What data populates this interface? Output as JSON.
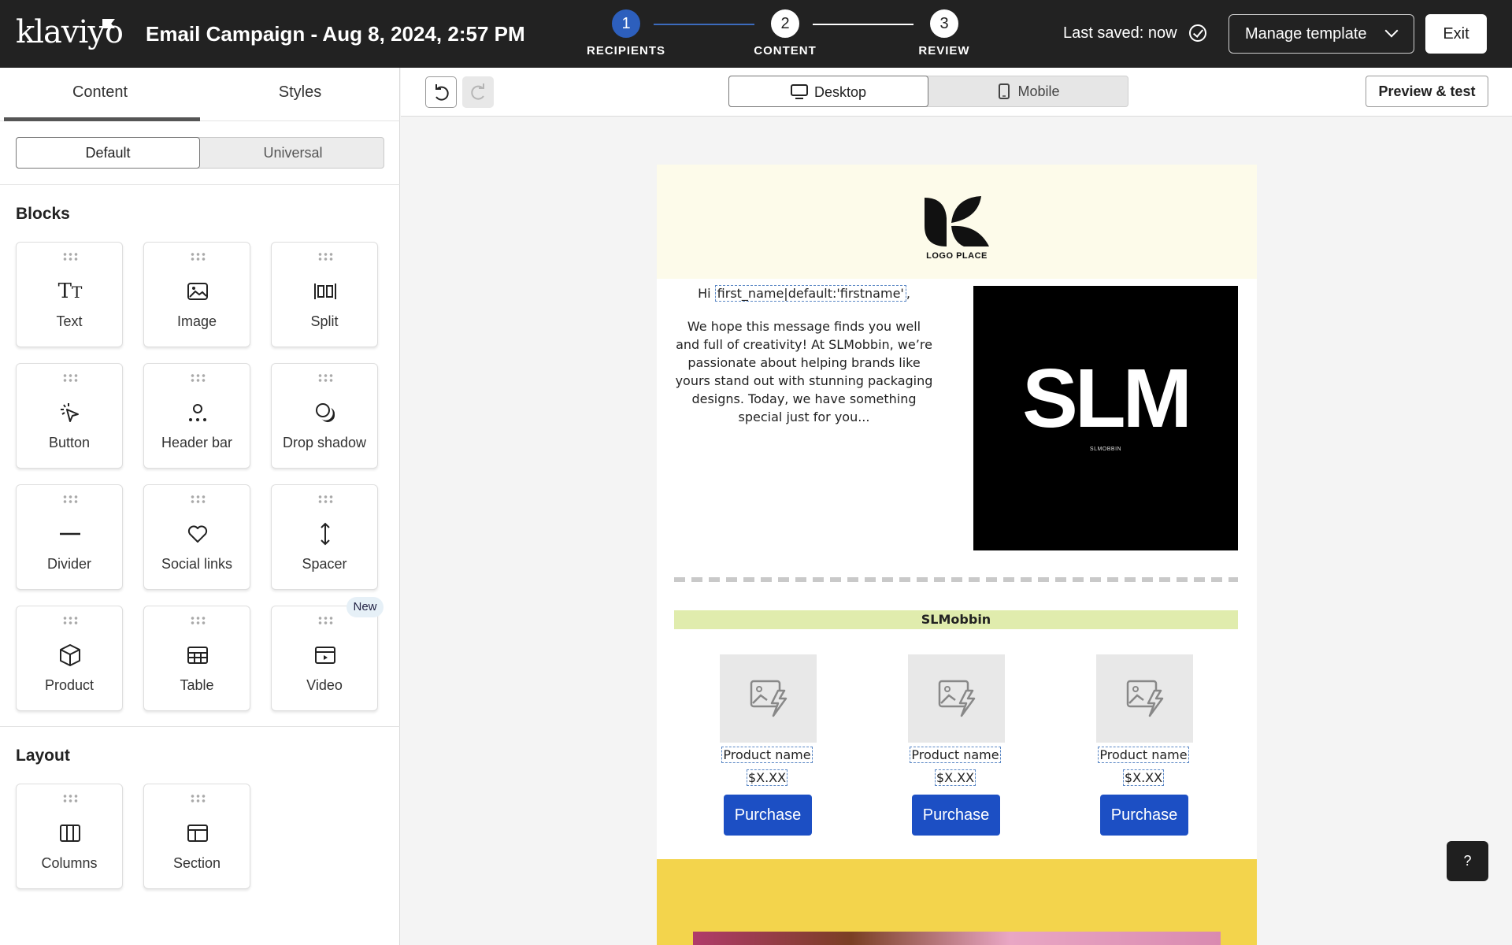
{
  "app": {
    "logo": "klaviyo"
  },
  "header": {
    "title": "Email Campaign - Aug 8, 2024, 2:57 PM",
    "steps": [
      {
        "number": "1",
        "label": "RECIPIENTS"
      },
      {
        "number": "2",
        "label": "CONTENT"
      },
      {
        "number": "3",
        "label": "REVIEW"
      }
    ],
    "last_saved": "Last saved: now",
    "manage_template": "Manage template",
    "exit": "Exit"
  },
  "left_panel": {
    "tabs": [
      "Content",
      "Styles"
    ],
    "segments": [
      "Default",
      "Universal"
    ],
    "blocks_title": "Blocks",
    "blocks": [
      {
        "label": "Text",
        "icon": "text-icon"
      },
      {
        "label": "Image",
        "icon": "image-icon"
      },
      {
        "label": "Split",
        "icon": "split-icon"
      },
      {
        "label": "Button",
        "icon": "button-cursor-icon"
      },
      {
        "label": "Header bar",
        "icon": "header-bar-icon"
      },
      {
        "label": "Drop shadow",
        "icon": "drop-shadow-icon"
      },
      {
        "label": "Divider",
        "icon": "divider-icon"
      },
      {
        "label": "Social links",
        "icon": "heart-icon"
      },
      {
        "label": "Spacer",
        "icon": "spacer-icon"
      },
      {
        "label": "Product",
        "icon": "cube-icon"
      },
      {
        "label": "Table",
        "icon": "table-icon"
      },
      {
        "label": "Video",
        "icon": "video-icon"
      }
    ],
    "new_badge": "New",
    "layout_title": "Layout",
    "layout": [
      {
        "label": "Columns",
        "icon": "columns-icon"
      },
      {
        "label": "Section",
        "icon": "section-icon"
      }
    ]
  },
  "toolbar": {
    "views": [
      "Desktop",
      "Mobile"
    ],
    "preview": "Preview & test"
  },
  "email": {
    "logo_text": "LOGO PLACE",
    "greeting_prefix": "Hi",
    "greeting_merge": "first_name|default:'firstname'",
    "greeting_suffix": ",",
    "intro": "We hope this message finds you well and full of creativity! At SLMobbin, we’re passionate about helping brands like yours stand out with stunning packaging designs. Today, we have something special just for you...",
    "hero_word": "SLM",
    "hero_sub": "SLMOBBIN",
    "banner": "SLMobbin",
    "products": [
      {
        "name": "Product name",
        "price": "$X.XX",
        "button": "Purchase"
      },
      {
        "name": "Product name",
        "price": "$X.XX",
        "button": "Purchase"
      },
      {
        "name": "Product name",
        "price": "$X.XX",
        "button": "Purchase"
      }
    ]
  },
  "help": "?",
  "colors": {
    "topbar": "#222222",
    "step_done": "#2d5fbd",
    "purchase": "#1c4fc4",
    "banner": "#e0ecad",
    "header_bg": "#fdfbea",
    "yellow": "#f3d44c"
  }
}
